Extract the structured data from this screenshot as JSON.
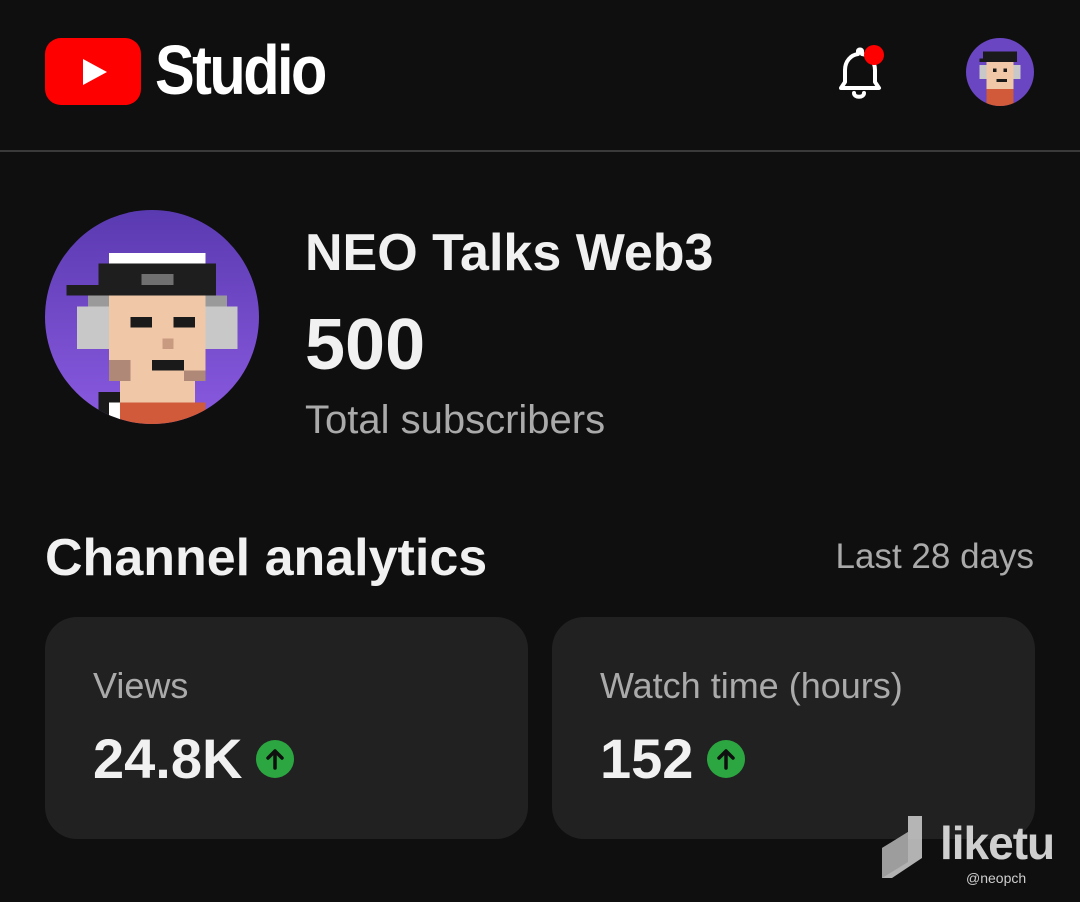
{
  "header": {
    "studio_label": "Studio",
    "notification_icon": "bell-icon",
    "notification_badge_color": "#ff0000",
    "logo_icon": "youtube-play-icon",
    "brand_color": "#ff0000"
  },
  "channel": {
    "name": "NEO Talks Web3",
    "subscriber_count": "500",
    "subscriber_label": "Total subscribers",
    "avatar_icon": "pixel-avatar-icon",
    "avatar_bg_color": "#6a46c2"
  },
  "analytics": {
    "title": "Channel analytics",
    "period": "Last 28 days",
    "cards": [
      {
        "label": "Views",
        "value": "24.8K",
        "trend": "up",
        "trend_icon": "arrow-up-icon"
      },
      {
        "label": "Watch time (hours)",
        "value": "152",
        "trend": "up",
        "trend_icon": "arrow-up-icon"
      }
    ],
    "trend_up_color": "#2ba640"
  },
  "watermark": {
    "brand": "liketu",
    "handle": "@neopch"
  }
}
